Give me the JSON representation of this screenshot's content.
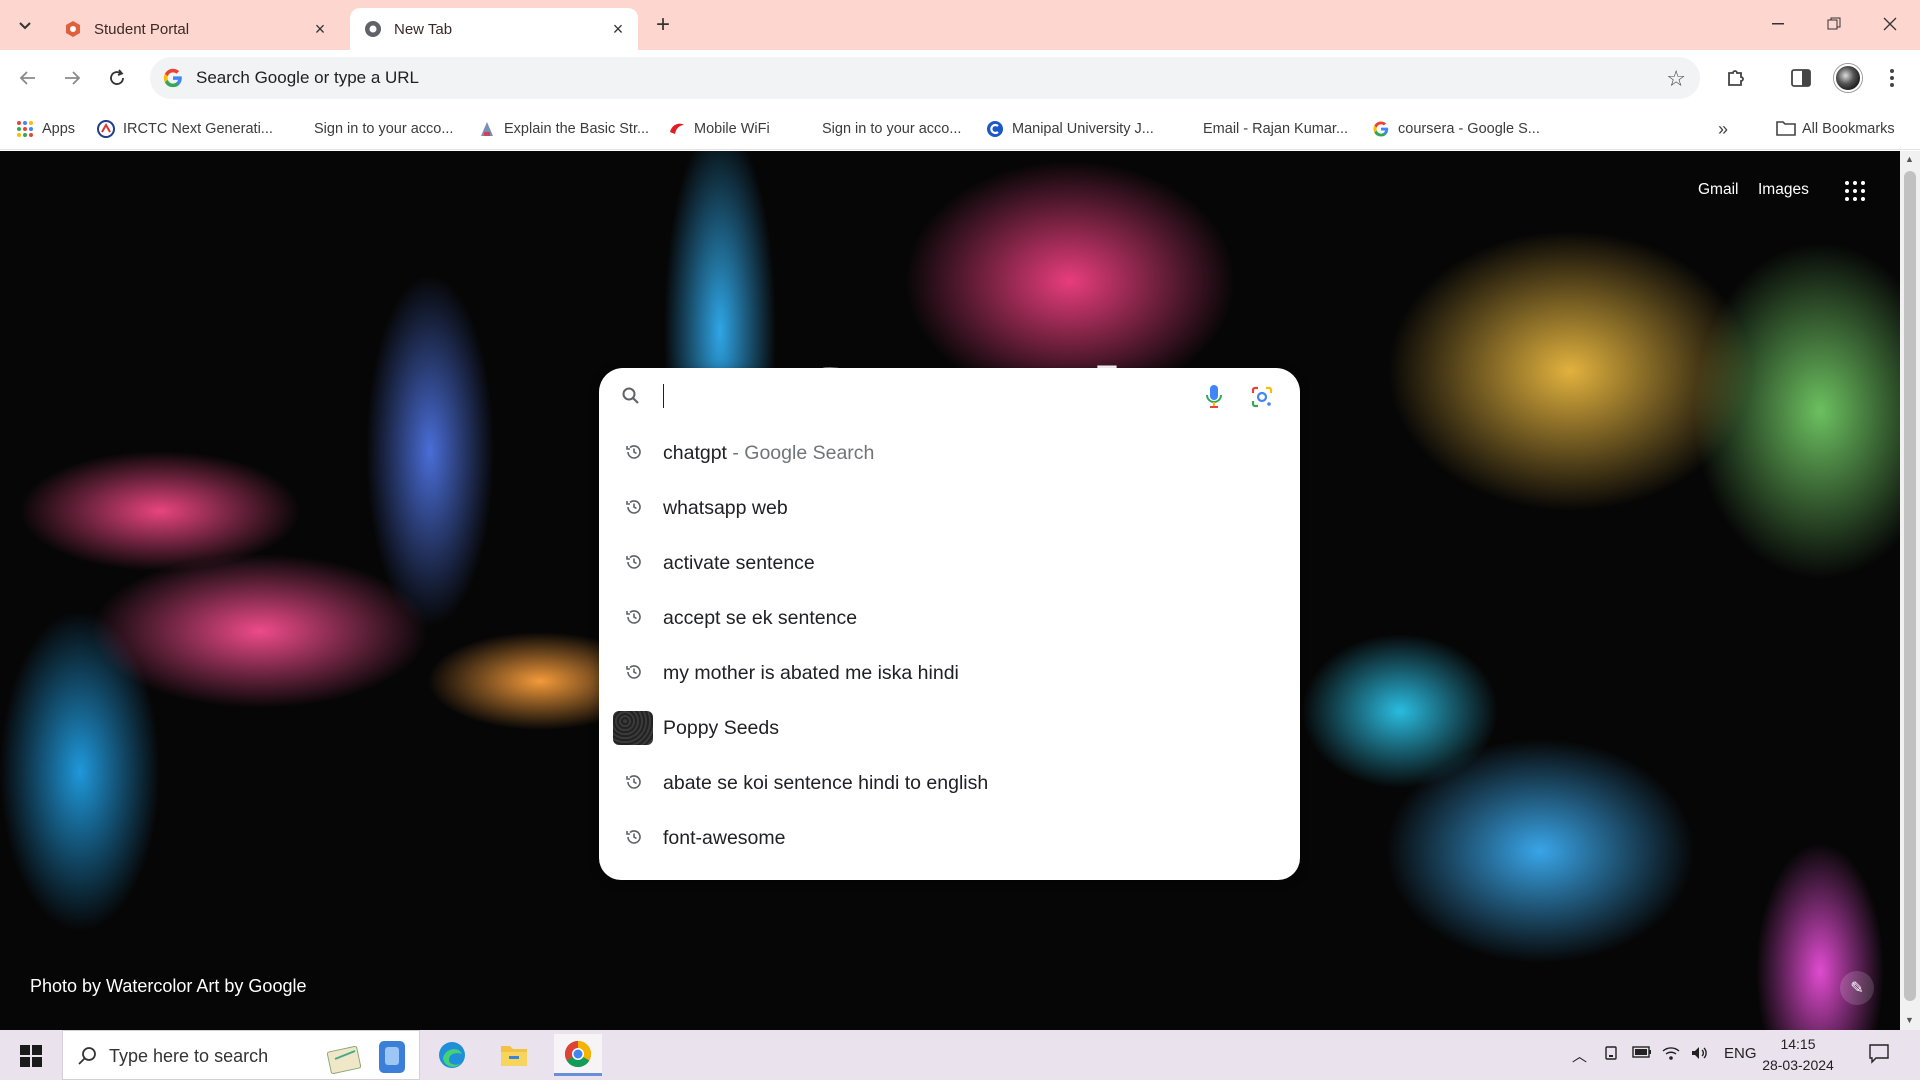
{
  "tabs": [
    {
      "title": "Student Portal",
      "active": false
    },
    {
      "title": "New Tab",
      "active": true
    }
  ],
  "toolbar": {
    "omnibox_placeholder": "Search Google or type a URL"
  },
  "bookmarks": {
    "apps_label": "Apps",
    "items": [
      {
        "label": "IRCTC Next Generati...",
        "icon": "irctc-icon"
      },
      {
        "label": "Sign in to your acco...",
        "icon": "microsoft-icon"
      },
      {
        "label": "Explain the Basic Str...",
        "icon": "page-icon"
      },
      {
        "label": "Mobile WiFi",
        "icon": "wifi-brand-icon"
      },
      {
        "label": "Sign in to your acco...",
        "icon": "microsoft-icon"
      },
      {
        "label": "Manipal University J...",
        "icon": "manipal-icon"
      },
      {
        "label": "Email - Rajan Kumar...",
        "icon": "microsoft-icon"
      },
      {
        "label": "coursera - Google S...",
        "icon": "google-icon"
      }
    ],
    "all_bookmarks_label": "All Bookmarks"
  },
  "ntp": {
    "gmail_label": "Gmail",
    "images_label": "Images",
    "logo_text": "Google",
    "credit": "Photo by Watercolor Art by Google"
  },
  "realbox": {
    "query": "",
    "suggestions": [
      {
        "text": "chatgpt",
        "suffix": " - Google Search",
        "icon": "history-icon"
      },
      {
        "text": "whatsapp web",
        "suffix": "",
        "icon": "history-icon"
      },
      {
        "text": "activate sentence",
        "suffix": "",
        "icon": "history-icon"
      },
      {
        "text": "accept se ek sentence",
        "suffix": "",
        "icon": "history-icon"
      },
      {
        "text": "my mother is abated me iska hindi",
        "suffix": "",
        "icon": "history-icon"
      },
      {
        "text": "Poppy Seeds",
        "suffix": "",
        "icon": "thumbnail"
      },
      {
        "text": "abate se koi sentence hindi to english",
        "suffix": "",
        "icon": "history-icon"
      },
      {
        "text": "font-awesome",
        "suffix": "",
        "icon": "history-icon"
      }
    ]
  },
  "taskbar": {
    "search_placeholder": "Type here to search",
    "language": "ENG",
    "time": "14:15",
    "date": "28-03-2024"
  },
  "colors": {
    "tabstrip": "#fcd6cf",
    "taskbar": "#eae3ee",
    "accent_blue": "#1a73e8"
  }
}
